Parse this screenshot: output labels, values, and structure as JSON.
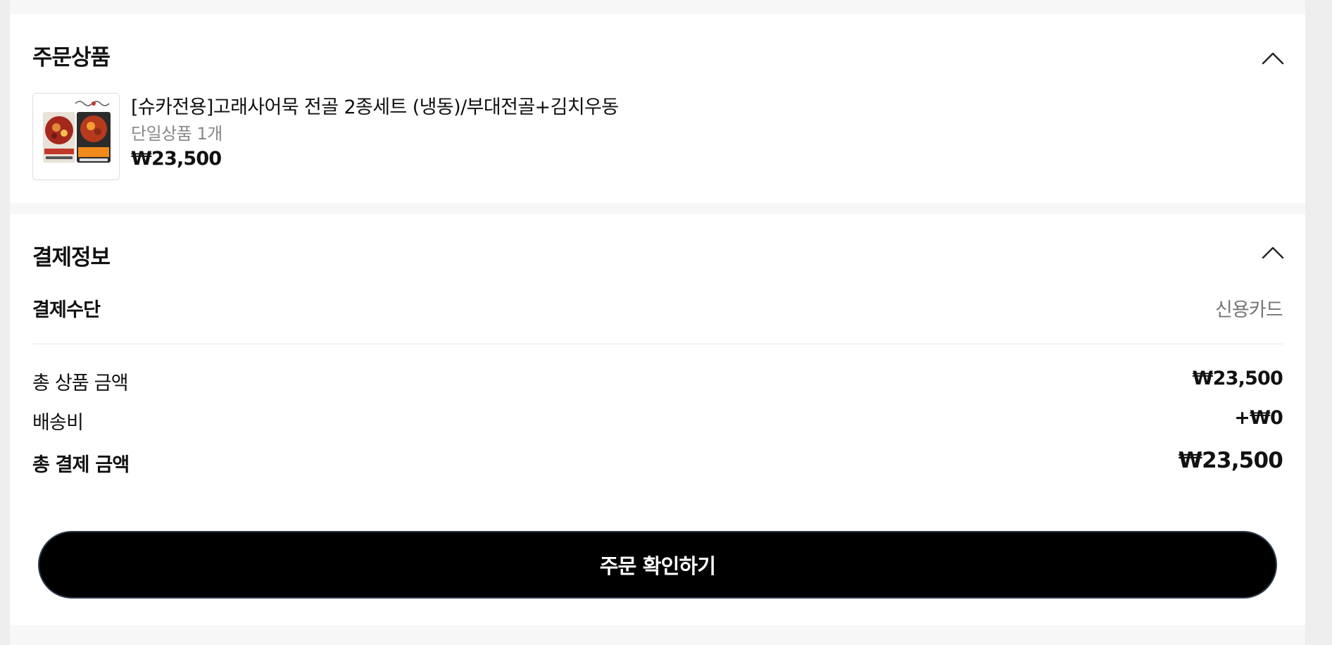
{
  "order_section": {
    "title": "주문상품",
    "product": {
      "name": "[슈카전용]고래사어묵 전골 2종세트 (냉동)/부대전골+김치우동",
      "option": "단일상품 1개",
      "price": "₩23,500",
      "thumbnail_icon": "product-image"
    }
  },
  "payment_section": {
    "title": "결제정보",
    "method_label": "결제수단",
    "method_value": "신용카드",
    "rows": [
      {
        "label": "총 상품 금액",
        "value": "₩23,500"
      },
      {
        "label": "배송비",
        "value": "+₩0"
      },
      {
        "label": "총 결제 금액",
        "value": "₩23,500"
      }
    ],
    "confirm_button": "주문 확인하기"
  },
  "colors": {
    "button_bg": "#000000",
    "page_bg": "#f7f7f7"
  }
}
